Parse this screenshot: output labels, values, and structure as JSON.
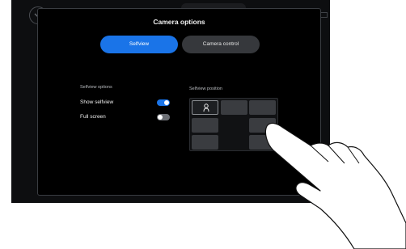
{
  "modal": {
    "title": "Camera options",
    "tabs": [
      {
        "label": "Selfview",
        "active": true
      },
      {
        "label": "Camera control",
        "active": false
      }
    ]
  },
  "selfview_options": {
    "heading": "Selfview options",
    "items": [
      {
        "label": "Show selfview",
        "enabled": true
      },
      {
        "label": "Full screen",
        "enabled": false
      }
    ]
  },
  "selfview_position": {
    "heading": "Selfview position",
    "selected_cell": "top-left"
  },
  "colors": {
    "accent": "#1a74e8",
    "background": "#000000",
    "inactive_tab": "#36383c"
  },
  "icons": [
    "chevron-down-icon",
    "camera-icon",
    "selfview-person-icon",
    "hand-pointer-icon"
  ]
}
